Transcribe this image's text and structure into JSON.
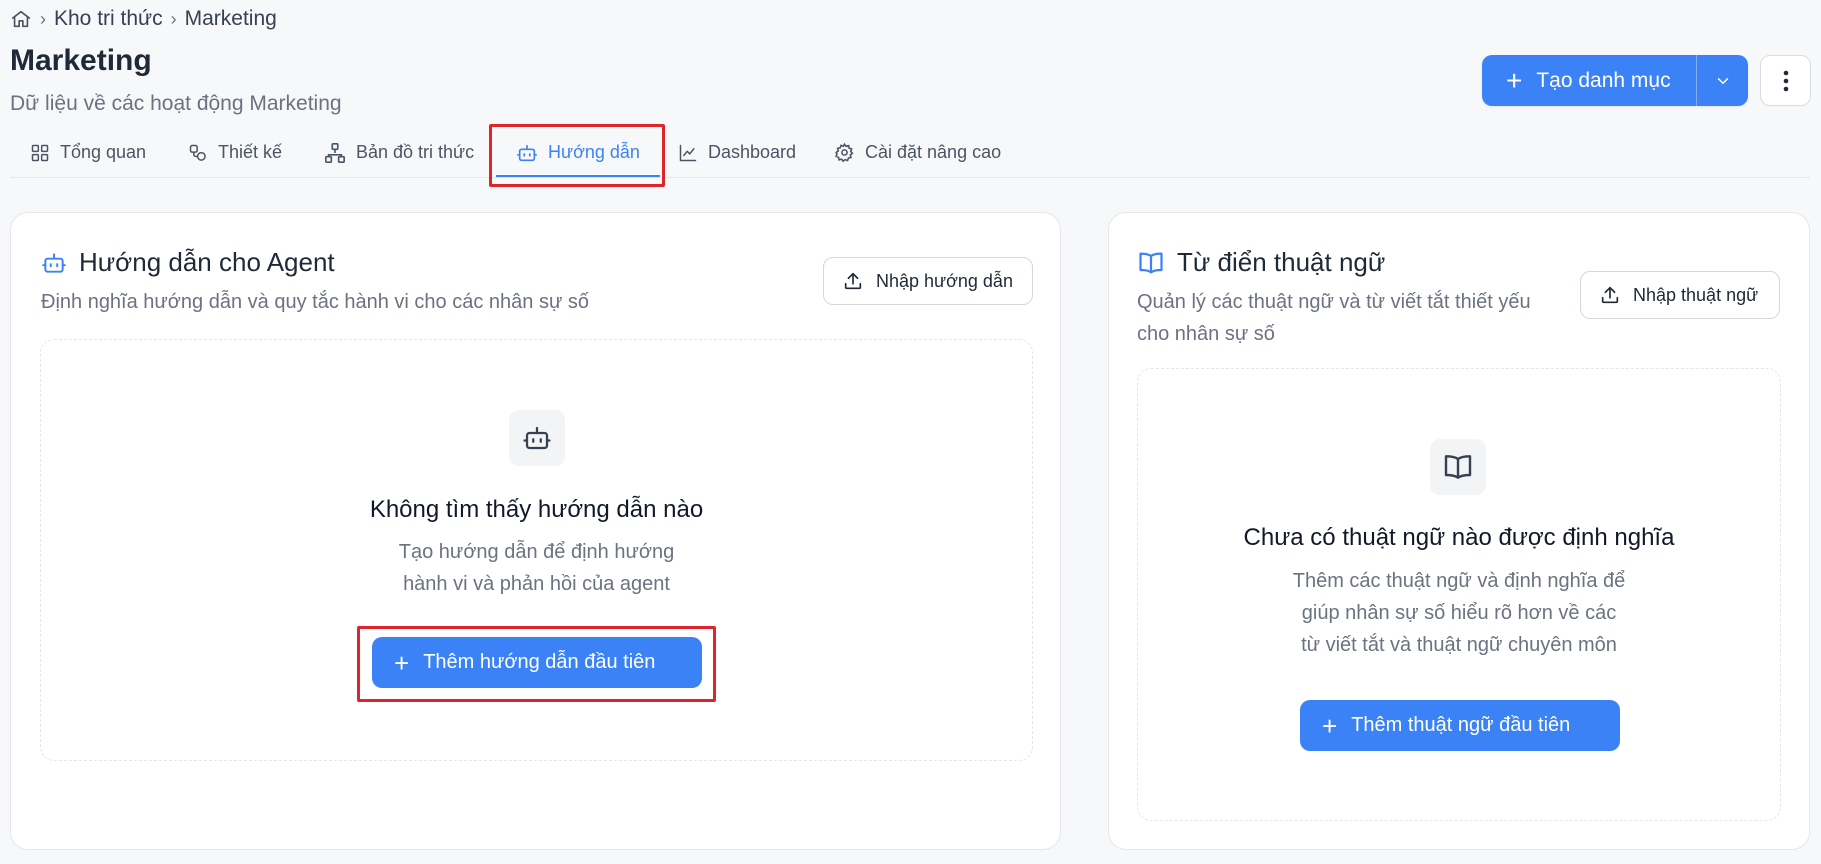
{
  "breadcrumb": {
    "home_icon": "home-icon",
    "items": [
      "Kho tri thức",
      "Marketing"
    ]
  },
  "header": {
    "title": "Marketing",
    "subtitle": "Dữ liệu về các hoạt động Marketing",
    "create_label": "Tạo danh mục"
  },
  "tabs": [
    {
      "label": "Tổng quan",
      "icon": "grid-icon"
    },
    {
      "label": "Thiết kế",
      "icon": "shapes-icon"
    },
    {
      "label": "Bản đồ tri thức",
      "icon": "network-icon"
    },
    {
      "label": "Hướng dẫn",
      "icon": "bot-icon",
      "active": true
    },
    {
      "label": "Dashboard",
      "icon": "chart-line-icon"
    },
    {
      "label": "Cài đặt nâng cao",
      "icon": "gear-icon"
    }
  ],
  "guides_card": {
    "title": "Hướng dẫn cho Agent",
    "subtitle": "Định nghĩa hướng dẫn và quy tắc hành vi cho các nhân sự số",
    "import_label": "Nhập hướng dẫn",
    "empty_title": "Không tìm thấy hướng dẫn nào",
    "empty_desc_line1": "Tạo hướng dẫn để định hướng",
    "empty_desc_line2": "hành vi và phản hồi của agent",
    "add_label": "Thêm hướng dẫn đầu tiên"
  },
  "glossary_card": {
    "title": "Từ điển thuật ngữ",
    "subtitle_line1": "Quản lý các thuật ngữ và từ viết tắt thiết yếu",
    "subtitle_line2": "cho nhân sự số",
    "import_label": "Nhập thuật ngữ",
    "empty_title": "Chưa có thuật ngữ nào được định nghĩa",
    "empty_desc_line1": "Thêm các thuật ngữ và định nghĩa để",
    "empty_desc_line2": "giúp nhân sự số hiểu rõ hơn về các",
    "empty_desc_line3": "từ viết tắt và thuật ngữ chuyên môn",
    "add_label": "Thêm thuật ngữ đầu tiên"
  },
  "colors": {
    "accent": "#3b82f6",
    "highlight": "#e0242b",
    "background": "#f7f8fa"
  }
}
